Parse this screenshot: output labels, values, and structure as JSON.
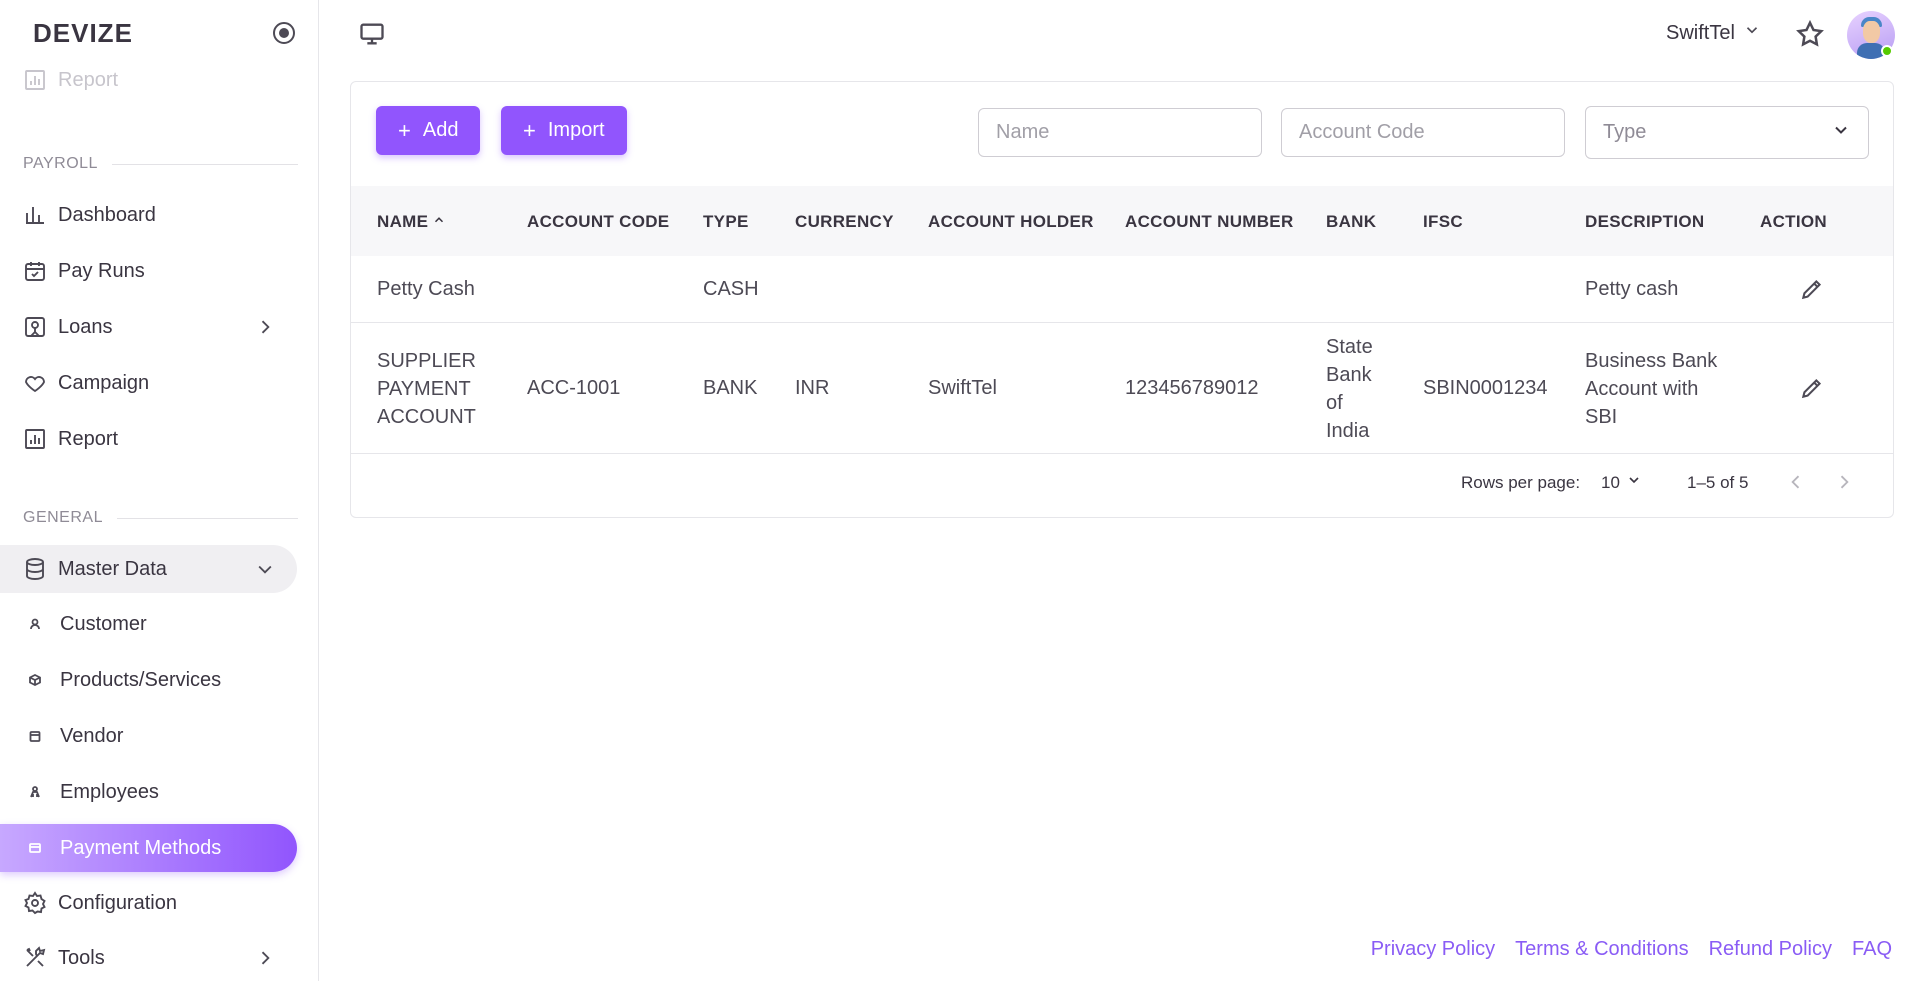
{
  "brand": {
    "name": "DEVIZE"
  },
  "sidebar": {
    "faded_item": "Report",
    "section_payroll": "PAYROLL",
    "payroll_items": [
      {
        "label": "Dashboard",
        "icon": "bar-chart-icon"
      },
      {
        "label": "Pay Runs",
        "icon": "calendar-check-icon"
      },
      {
        "label": "Loans",
        "icon": "loan-icon"
      },
      {
        "label": "Campaign",
        "icon": "heart-icon"
      },
      {
        "label": "Report",
        "icon": "report-icon"
      }
    ],
    "section_general": "GENERAL",
    "master_data": "Master Data",
    "sub_items": [
      {
        "label": "Customer",
        "icon": "person-icon"
      },
      {
        "label": "Products/Services",
        "icon": "cube-icon"
      },
      {
        "label": "Vendor",
        "icon": "store-icon"
      },
      {
        "label": "Employees",
        "icon": "people-icon"
      },
      {
        "label": "Payment Methods",
        "icon": "card-icon",
        "active": true
      }
    ],
    "configuration": "Configuration",
    "tools": "Tools"
  },
  "topbar": {
    "company": "SwiftTel"
  },
  "toolbar": {
    "add_label": "Add",
    "import_label": "Import",
    "name_placeholder": "Name",
    "account_code_placeholder": "Account Code",
    "type_placeholder": "Type"
  },
  "table": {
    "columns": [
      "NAME",
      "ACCOUNT CODE",
      "TYPE",
      "CURRENCY",
      "ACCOUNT HOLDER",
      "ACCOUNT NUMBER",
      "BANK",
      "IFSC",
      "DESCRIPTION",
      "ACTION"
    ],
    "rows": [
      {
        "name": "Petty Cash",
        "account_code": "",
        "type": "CASH",
        "currency": "",
        "account_holder": "",
        "account_number": "",
        "bank": "",
        "ifsc": "",
        "description": "Petty cash"
      },
      {
        "name": "SUPPLIER PAYMENT ACCOUNT",
        "account_code": "ACC-1001",
        "type": "BANK",
        "currency": "INR",
        "account_holder": "SwiftTel",
        "account_number": "123456789012",
        "bank": "State Bank of India",
        "ifsc": "SBIN0001234",
        "description": "Business Bank Account with SBI"
      }
    ]
  },
  "pagination": {
    "rows_per_page_label": "Rows per page:",
    "rows_per_page": "10",
    "range": "1–5 of 5"
  },
  "footer": {
    "links": [
      "Privacy Policy",
      "Terms & Conditions",
      "Refund Policy",
      "FAQ"
    ]
  },
  "colors": {
    "accent": "#9155fd",
    "link": "#8a5cf5"
  }
}
